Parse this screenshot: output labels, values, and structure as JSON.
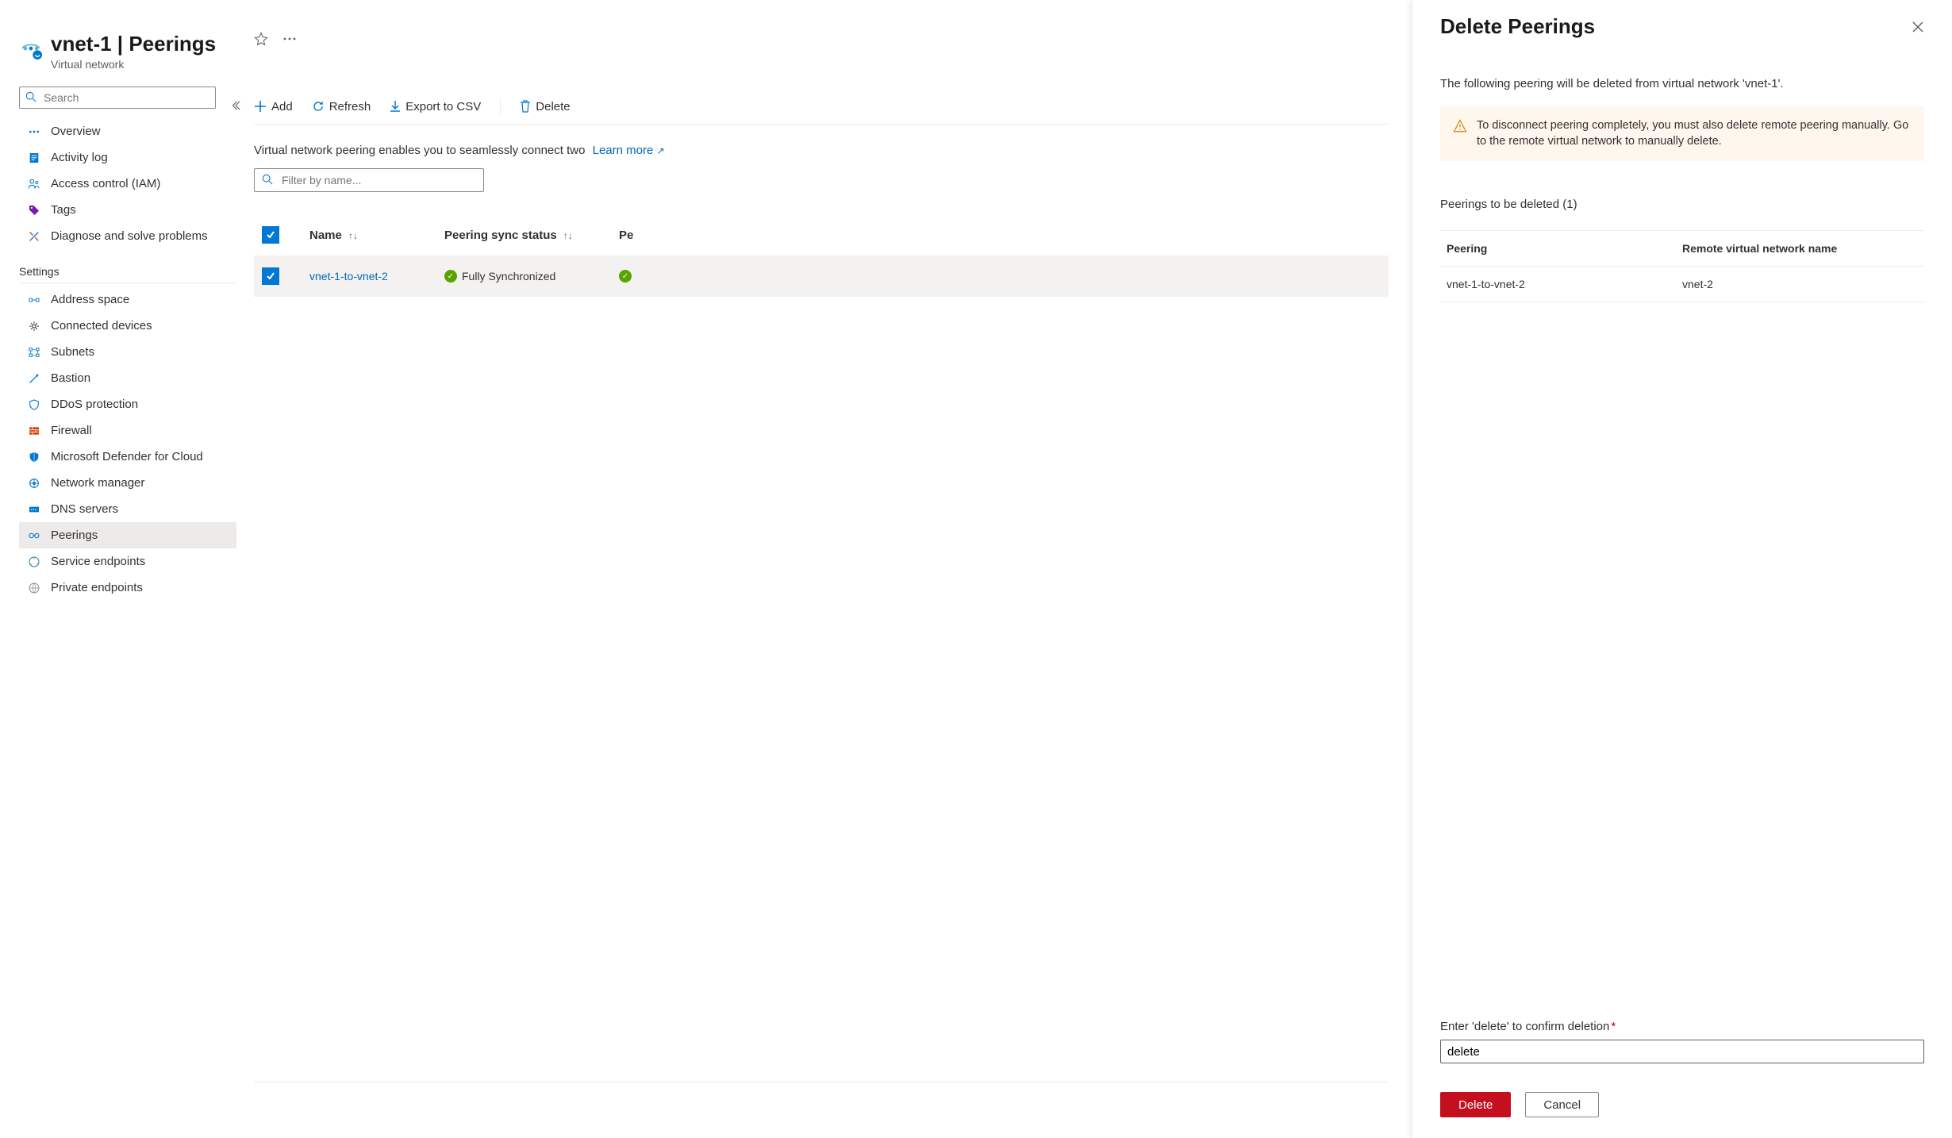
{
  "header": {
    "title": "vnet-1",
    "separator": " | ",
    "section": "Peerings",
    "subtitle": "Virtual network"
  },
  "sidebar": {
    "search_placeholder": "Search",
    "top_items": [
      {
        "label": "Overview",
        "icon": "vnet-icon",
        "color": "#0078d4"
      },
      {
        "label": "Activity log",
        "icon": "activity-log-icon",
        "color": "#0078d4"
      },
      {
        "label": "Access control (IAM)",
        "icon": "access-control-icon",
        "color": "#0078d4"
      },
      {
        "label": "Tags",
        "icon": "tags-icon",
        "color": "#0078d4"
      },
      {
        "label": "Diagnose and solve problems",
        "icon": "diagnose-icon",
        "color": "#0078d4"
      }
    ],
    "section_label": "Settings",
    "settings_items": [
      {
        "label": "Address space",
        "icon": "address-space-icon",
        "color": "#0078d4"
      },
      {
        "label": "Connected devices",
        "icon": "connected-devices-icon",
        "color": "#323130"
      },
      {
        "label": "Subnets",
        "icon": "subnets-icon",
        "color": "#0078d4"
      },
      {
        "label": "Bastion",
        "icon": "bastion-icon",
        "color": "#0078d4"
      },
      {
        "label": "DDoS protection",
        "icon": "ddos-icon",
        "color": "#0078d4"
      },
      {
        "label": "Firewall",
        "icon": "firewall-icon",
        "color": "#d83b01"
      },
      {
        "label": "Microsoft Defender for Cloud",
        "icon": "defender-icon",
        "color": "#0078d4"
      },
      {
        "label": "Network manager",
        "icon": "network-manager-icon",
        "color": "#0078d4"
      },
      {
        "label": "DNS servers",
        "icon": "dns-icon",
        "color": "#0078d4"
      },
      {
        "label": "Peerings",
        "icon": "peerings-icon",
        "color": "#0078d4",
        "active": true
      },
      {
        "label": "Service endpoints",
        "icon": "service-endpoints-icon",
        "color": "#0078d4"
      },
      {
        "label": "Private endpoints",
        "icon": "private-endpoints-icon",
        "color": "#605e5c"
      }
    ]
  },
  "toolbar": {
    "add": "Add",
    "refresh": "Refresh",
    "export": "Export to CSV",
    "delete": "Delete"
  },
  "main": {
    "desc": "Virtual network peering enables you to seamlessly connect two",
    "learn_more": "Learn more",
    "filter_placeholder": "Filter by name...",
    "columns": {
      "name": "Name",
      "sync": "Peering sync status",
      "tail": "Pe"
    },
    "row": {
      "name": "vnet-1-to-vnet-2",
      "sync": "Fully Synchronized"
    }
  },
  "panel": {
    "title": "Delete Peerings",
    "subtitle": "The following peering will be deleted from virtual network 'vnet-1'.",
    "warning_text": "To disconnect peering completely, you must also delete remote peering manually. Go to the remote virtual network to manually delete.",
    "count_label": "Peerings to be deleted (1)",
    "columns": {
      "peering": "Peering",
      "remote": "Remote virtual network name"
    },
    "row": {
      "peering": "vnet-1-to-vnet-2",
      "remote": "vnet-2"
    },
    "confirm_label": "Enter 'delete' to confirm deletion",
    "confirm_value": "delete",
    "delete_btn": "Delete",
    "cancel_btn": "Cancel"
  }
}
